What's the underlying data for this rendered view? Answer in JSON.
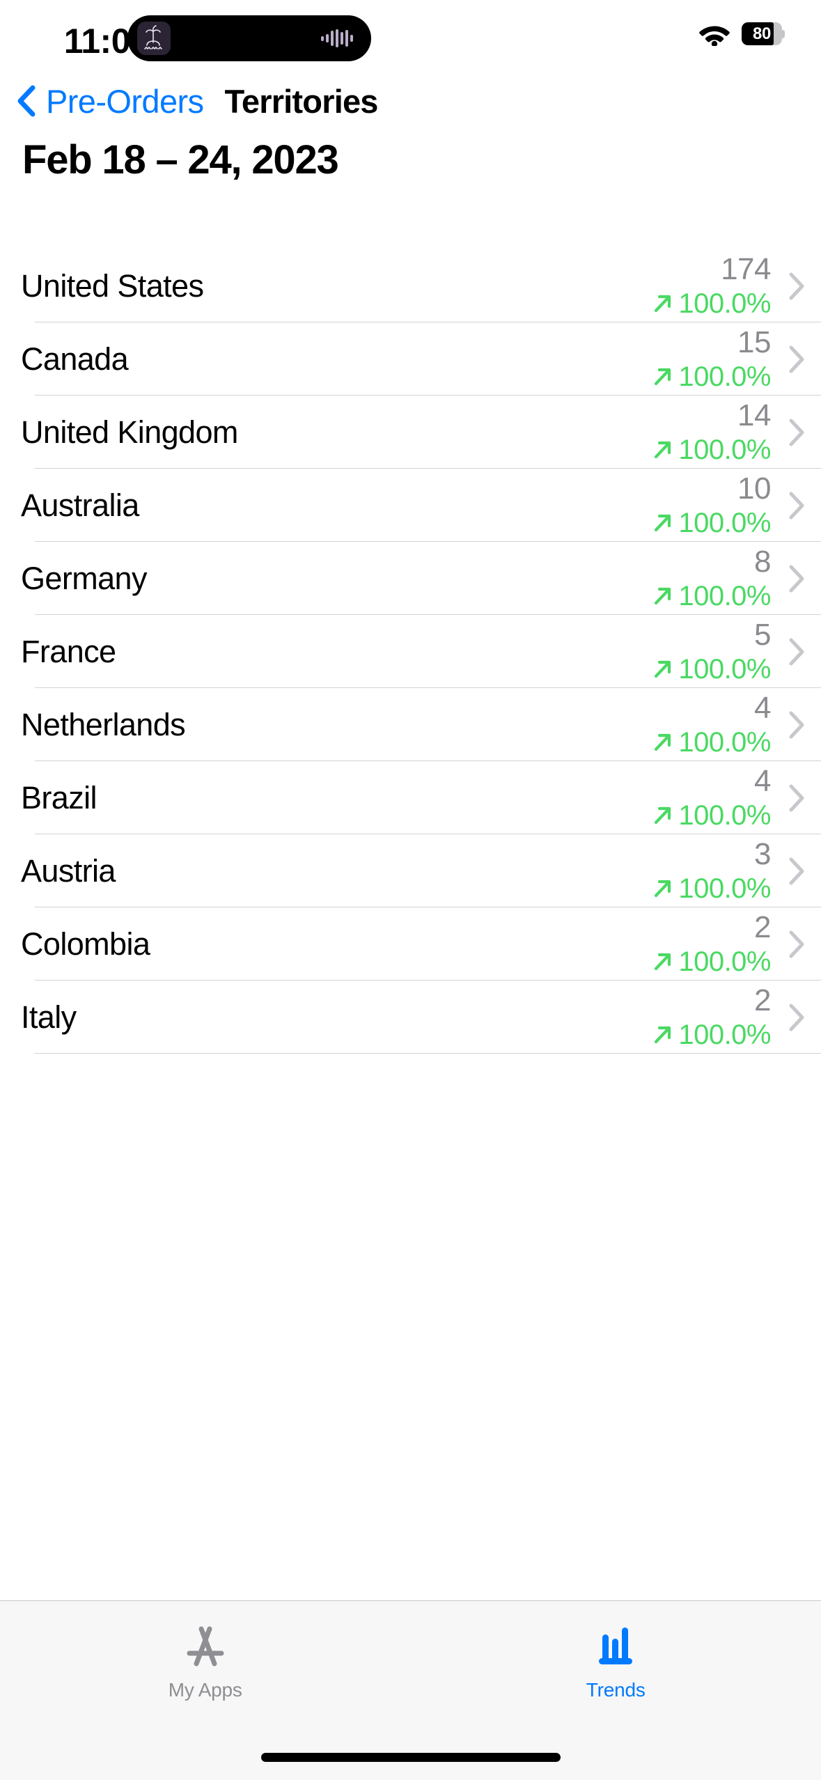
{
  "status_bar": {
    "time": "11:01",
    "battery_percent": "80",
    "battery_level_pct": 80,
    "wifi_icon": "wifi-icon",
    "dynamic_island": {
      "app_icon": "palm-tree-app-icon",
      "activity_icon": "audio-waveform-icon"
    }
  },
  "nav": {
    "back_label": "Pre-Orders",
    "back_icon": "chevron-left-icon",
    "title": "Territories"
  },
  "header": {
    "date_range": "Feb 18 – 24, 2023"
  },
  "list": {
    "trend_up_icon": "arrow-up-right-icon",
    "disclosure_icon": "chevron-right-icon",
    "colors": {
      "positive": "#4AD963",
      "value_gray": "#8B8B8F",
      "chevron_gray": "#C7C7CC",
      "accent_blue": "#007AFF"
    },
    "rows": [
      {
        "territory": "United States",
        "value": "174",
        "delta": "100.0%",
        "direction": "up"
      },
      {
        "territory": "Canada",
        "value": "15",
        "delta": "100.0%",
        "direction": "up"
      },
      {
        "territory": "United Kingdom",
        "value": "14",
        "delta": "100.0%",
        "direction": "up"
      },
      {
        "territory": "Australia",
        "value": "10",
        "delta": "100.0%",
        "direction": "up"
      },
      {
        "territory": "Germany",
        "value": "8",
        "delta": "100.0%",
        "direction": "up"
      },
      {
        "territory": "France",
        "value": "5",
        "delta": "100.0%",
        "direction": "up"
      },
      {
        "territory": "Netherlands",
        "value": "4",
        "delta": "100.0%",
        "direction": "up"
      },
      {
        "territory": "Brazil",
        "value": "4",
        "delta": "100.0%",
        "direction": "up"
      },
      {
        "territory": "Austria",
        "value": "3",
        "delta": "100.0%",
        "direction": "up"
      },
      {
        "territory": "Colombia",
        "value": "2",
        "delta": "100.0%",
        "direction": "up"
      },
      {
        "territory": "Italy",
        "value": "2",
        "delta": "100.0%",
        "direction": "up"
      }
    ]
  },
  "tab_bar": {
    "items": [
      {
        "label": "My Apps",
        "icon": "app-store-icon",
        "active": false
      },
      {
        "label": "Trends",
        "icon": "bar-chart-icon",
        "active": true
      }
    ]
  }
}
